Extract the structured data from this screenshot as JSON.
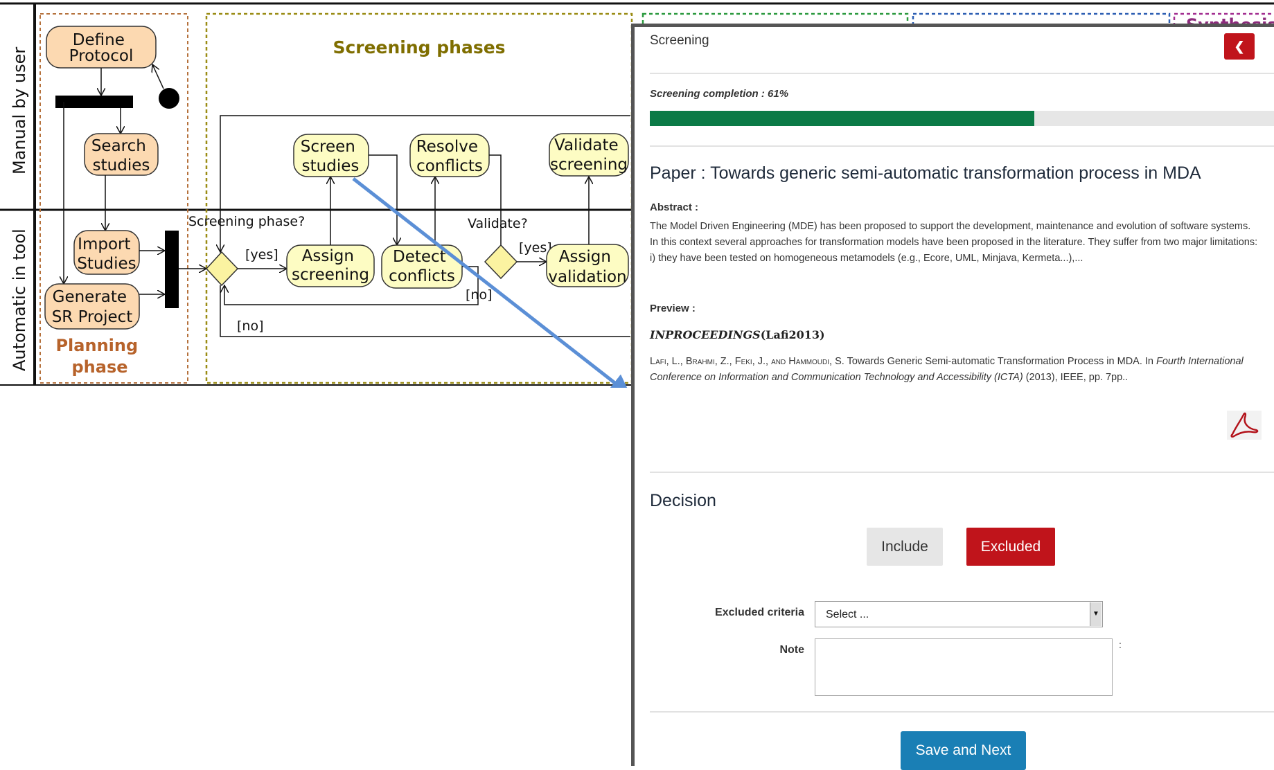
{
  "diagram": {
    "lanes": [
      "Manual by user",
      "Automatic in tool"
    ],
    "phase_titles": {
      "screening": "Screening phases",
      "planning": "Planning phase",
      "synthesis_partial": "Synthesis"
    },
    "nodes": {
      "define_protocol": "Define Protocol",
      "search_studies": "Search studies",
      "import_studies": "Import Studies",
      "generate_sr_project": "Generate SR Project",
      "screen_studies": "Screen studies",
      "resolve_conflicts": "Resolve conflicts",
      "validate_screening": "Validate screening",
      "assign_screening": "Assign screening",
      "detect_conflicts": "Detect conflicts",
      "assign_validation": "Assign validation"
    },
    "decisions": {
      "screening_phase": "Screening phase?",
      "validate": "Validate?"
    },
    "edge_labels": {
      "yes1": "[yes]",
      "no1": "[no]",
      "yes2": "[yes]",
      "no2": "[no]"
    },
    "colors": {
      "planning_fill": "#fcd9b1",
      "planning_border": "#b5713c",
      "planning_title": "#b7632b",
      "screening_fill": "#fdfcc3",
      "screening_border": "#9a8c14",
      "screening_title": "#7f6e00",
      "decision_fill": "#fbf3a1",
      "arrow_blue": "#5b8fd6"
    }
  },
  "panel": {
    "title": "Screening",
    "back_icon": "arrow-left-icon",
    "completion_label": "Screening completion : 61%",
    "completion_fraction": 0.61,
    "paper_title": "Paper : Towards generic semi-automatic transformation process in MDA",
    "abstract_label": "Abstract :",
    "abstract_text": "The Model Driven Engineering (MDE) has been proposed to support the development, maintenance and evolution of software systems. In this context several approaches for transformation models have been proposed in the literature. They suffer from two major limitations: i) they have been tested on homogeneous metamodels (e.g., Ecore, UML, Minjava, Kermeta...),...",
    "preview_label": "Preview :",
    "bib_type": "INPROCEEDINGS",
    "bib_key": "(Lafi2013)",
    "citation_authors": "Lafi, L., Brahmi, Z., Feki, J., and Hammoudi, S.",
    "citation_title": "Towards Generic Semi-automatic Transformation Process in MDA. In",
    "citation_venue": "Fourth International Conference on Information and Communication Technology and Accessibility (ICTA)",
    "citation_tail": "(2013), IEEE, pp. 7pp..",
    "pdf_icon": "pdf-icon",
    "decision_heading": "Decision",
    "include_label": "Include",
    "excluded_label": "Excluded",
    "excluded_criteria_label": "Excluded criteria",
    "select_value": "Select ...",
    "note_label": "Note",
    "note_colon": ":",
    "save_label": "Save and Next",
    "colors": {
      "progress": "#0b7a46",
      "excluded": "#c0141b",
      "save": "#1a7fb5",
      "include": "#e6e6e6"
    }
  }
}
